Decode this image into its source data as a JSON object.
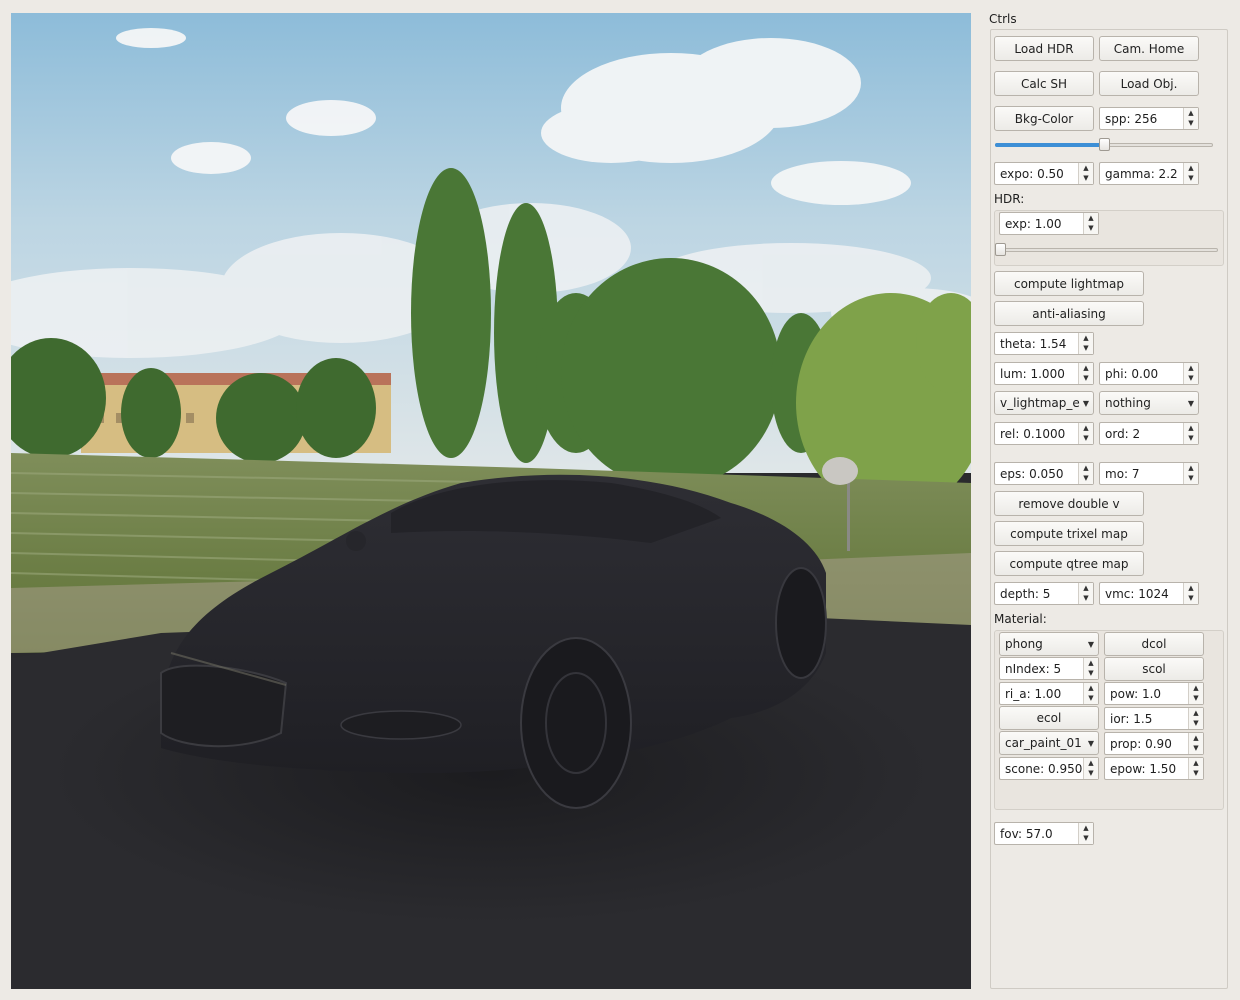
{
  "panel": {
    "title": "Ctrls",
    "buttons": {
      "load_hdr": "Load HDR",
      "cam_home": "Cam. Home",
      "calc_sh": "Calc SH",
      "load_obj": "Load Obj.",
      "bkg_color": "Bkg-Color",
      "compute_lightmap": "compute lightmap",
      "anti_aliasing": "anti-aliasing",
      "remove_double_v": "remove double v",
      "compute_trixel_map": "compute trixel map",
      "compute_qtree_map": "compute qtree map"
    },
    "spp": "spp: 256",
    "spp_slider": {
      "value": 256,
      "fraction": 0.5
    },
    "expo": "expo: 0.50",
    "gamma": "gamma: 2.2",
    "hdr": {
      "label": "HDR:",
      "exp": "exp: 1.00",
      "slider": {
        "fraction": 0.0
      }
    },
    "theta": "theta: 1.54",
    "lum": "lum: 1.000",
    "phi": "phi: 0.00",
    "lightmap_select": "v_lightmap_e",
    "mode_select": "nothing",
    "rel": "rel: 0.1000",
    "ord": "ord: 2",
    "eps": "eps: 0.050",
    "mo": "mo: 7",
    "depth": "depth: 5",
    "vmc": "vmc: 1024",
    "material": {
      "label": "Material:",
      "shader_select": "phong",
      "dcol": "dcol",
      "nindex": "nIndex: 5",
      "scol": "scol",
      "ri_a": "ri_a: 1.00",
      "pow": "pow: 1.0",
      "ecol": "ecol",
      "ior": "ior: 1.5",
      "material_select": "car_paint_01",
      "prop": "prop: 0.90",
      "scone": "scone: 0.950",
      "epow": "epow: 1.50"
    },
    "fov": "fov: 57.0"
  },
  "icons": {
    "spin_up": "▲",
    "spin_down": "▼",
    "combo_caret": "▼"
  },
  "colors": {
    "window_bg": "#edeae5",
    "slider_fill": "#3d8fd6",
    "ground": "#2a2a2d",
    "sky_top": "#8cbbd8"
  }
}
